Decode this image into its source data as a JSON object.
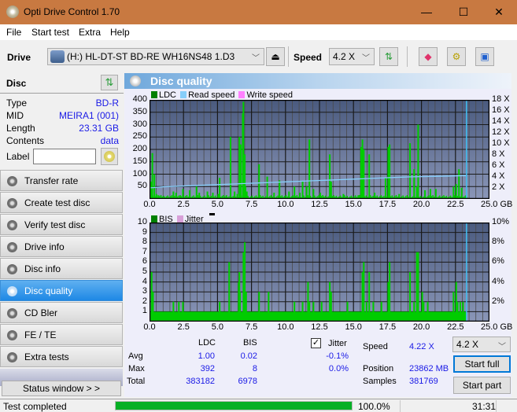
{
  "window": {
    "title": "Opti Drive Control 1.70",
    "minimize": "—",
    "maximize": "☐",
    "close": "✕"
  },
  "menu": [
    "File",
    "Start test",
    "Extra",
    "Help"
  ],
  "toolbar": {
    "drive_label": "Drive",
    "drive_value": "(H:)   HL-DT-ST BD-RE  WH16NS48 1.D3",
    "speed_label": "Speed",
    "speed_value": "4.2 X",
    "icons": [
      "eject-icon",
      "refresh-icon",
      "eraser-icon",
      "settings-icon",
      "save-icon"
    ]
  },
  "disc": {
    "header": "Disc",
    "type_label": "Type",
    "type_value": "BD-R",
    "mid_label": "MID",
    "mid_value": "MEIRA1 (001)",
    "length_label": "Length",
    "length_value": "23.31 GB",
    "contents_label": "Contents",
    "contents_value": "data",
    "label_label": "Label",
    "label_value": ""
  },
  "nav": [
    {
      "label": "Transfer rate",
      "active": false
    },
    {
      "label": "Create test disc",
      "active": false
    },
    {
      "label": "Verify test disc",
      "active": false
    },
    {
      "label": "Drive info",
      "active": false
    },
    {
      "label": "Disc info",
      "active": false
    },
    {
      "label": "Disc quality",
      "active": true
    },
    {
      "label": "CD Bler",
      "active": false
    },
    {
      "label": "FE / TE",
      "active": false
    },
    {
      "label": "Extra tests",
      "active": false
    }
  ],
  "status_window_button": "Status window > >",
  "panel": {
    "title": "Disc quality"
  },
  "colors": {
    "ldc": "#008000",
    "bis": "#008000",
    "read_speed": "#87cefa",
    "write_speed": "#ff80ff",
    "jitter": "#d8a0d8",
    "bar_green": "#00cc00",
    "accent": "#1e88e5",
    "progress": "#06b025"
  },
  "chart_data": [
    {
      "type": "bar",
      "title": "LDC / Read speed",
      "legend": [
        "LDC",
        "Read speed",
        "Write speed"
      ],
      "legend_position": "top-left",
      "xlabel": "GB",
      "xlim": [
        0,
        25
      ],
      "x_ticks": [
        "0.0",
        "2.5",
        "5.0",
        "7.5",
        "10.0",
        "12.5",
        "15.0",
        "17.5",
        "20.0",
        "22.5",
        "25.0 GB"
      ],
      "ylim": [
        0,
        400
      ],
      "y_ticks": [
        "400",
        "350",
        "300",
        "250",
        "200",
        "150",
        "100",
        "50"
      ],
      "y2lim": [
        0,
        18
      ],
      "y2_ticks": [
        "18 X",
        "16 X",
        "14 X",
        "12 X",
        "10 X",
        "8 X",
        "6 X",
        "4 X",
        "2 X"
      ],
      "grid": true,
      "end_marker_gb": 23.31,
      "series": [
        {
          "name": "LDC",
          "x": [
            0.05,
            0.15,
            0.3,
            0.45,
            0.6,
            1.0,
            1.7,
            1.9,
            2.2,
            2.4,
            2.9,
            3.4,
            3.6,
            4.2,
            4.6,
            5.0,
            5.1,
            5.6,
            5.9,
            6.2,
            6.4,
            6.55,
            6.65,
            6.8,
            6.85,
            6.95,
            7.0,
            7.1,
            8.0,
            8.6,
            9.1,
            9.5,
            10.2,
            10.6,
            11.0,
            11.2,
            11.5,
            11.7,
            12.0,
            12.5,
            12.7,
            13.2,
            13.3,
            14.2,
            15.3,
            15.5,
            15.6,
            15.7,
            16.1,
            16.5,
            17.3,
            17.5,
            17.6,
            18.3,
            19.1,
            19.4,
            19.6,
            19.7,
            20.2,
            20.6,
            21.0,
            22.3,
            22.5,
            22.7,
            22.9
          ],
          "values": [
            70,
            185,
            100,
            20,
            15,
            10,
            30,
            25,
            15,
            40,
            35,
            50,
            25,
            30,
            25,
            20,
            85,
            15,
            250,
            30,
            20,
            250,
            220,
            345,
            392,
            180,
            50,
            30,
            140,
            90,
            25,
            75,
            30,
            50,
            25,
            70,
            50,
            240,
            40,
            25,
            10,
            180,
            70,
            20,
            15,
            210,
            240,
            200,
            180,
            25,
            85,
            210,
            220,
            20,
            225,
            120,
            50,
            300,
            35,
            40,
            40,
            50,
            60,
            120,
            45
          ]
        },
        {
          "name": "Read speed",
          "x": [
            0,
            1,
            2,
            3,
            4,
            5,
            6,
            7,
            8,
            9,
            10,
            11,
            12,
            13,
            14,
            15,
            16,
            17,
            18,
            19,
            20,
            21,
            22,
            23,
            23.31
          ],
          "values": [
            2.0,
            2.2,
            2.3,
            2.4,
            2.5,
            2.6,
            2.7,
            2.8,
            2.9,
            3.0,
            3.1,
            3.2,
            3.3,
            3.4,
            3.5,
            3.6,
            3.7,
            3.8,
            3.9,
            4.0,
            4.05,
            4.1,
            4.15,
            4.22,
            4.22
          ]
        },
        {
          "name": "Write speed",
          "x": [],
          "values": []
        }
      ]
    },
    {
      "type": "bar",
      "title": "BIS / Jitter",
      "legend": [
        "BIS",
        "Jitter"
      ],
      "legend_position": "top-left",
      "xlabel": "GB",
      "xlim": [
        0,
        25
      ],
      "x_ticks": [
        "0.0",
        "2.5",
        "5.0",
        "7.5",
        "10.0",
        "12.5",
        "15.0",
        "17.5",
        "20.0",
        "22.5",
        "25.0 GB"
      ],
      "ylim": [
        0,
        10
      ],
      "y_ticks": [
        "10",
        "9",
        "8",
        "7",
        "6",
        "5",
        "4",
        "3",
        "2",
        "1"
      ],
      "y2lim": [
        0,
        10
      ],
      "y2_ticks": [
        "10%",
        "8%",
        "6%",
        "4%",
        "2%"
      ],
      "grid": true,
      "end_marker_gb": 23.31,
      "baseline": 1,
      "series": [
        {
          "name": "BIS",
          "x": [
            0.1,
            0.2,
            1.7,
            2.1,
            2.4,
            5.1,
            5.8,
            6.5,
            6.55,
            6.6,
            6.85,
            6.95,
            7.05,
            8.0,
            8.7,
            10.6,
            11.2,
            11.6,
            11.7,
            12.0,
            12.6,
            13.2,
            13.3,
            14.5,
            15.6,
            15.7,
            15.9,
            16.1,
            16.4,
            17.0,
            17.5,
            17.6,
            19.1,
            19.4,
            19.6,
            19.7,
            20.0,
            20.1,
            20.4,
            22.3,
            22.5,
            22.6,
            22.8,
            23.0
          ],
          "values": [
            5,
            3,
            2,
            2,
            2,
            2,
            6,
            4,
            5,
            3,
            7,
            8,
            3,
            3,
            3,
            2,
            2,
            4,
            2,
            2,
            2,
            4,
            3,
            2,
            5,
            6,
            2,
            5,
            2,
            2,
            4,
            6,
            5,
            2,
            7,
            7,
            3,
            2,
            2,
            3,
            4,
            2,
            2,
            2
          ]
        },
        {
          "name": "Jitter",
          "x": [],
          "values": []
        }
      ]
    }
  ],
  "stats": {
    "col_ldc": "LDC",
    "col_bis": "BIS",
    "col_jitter": "Jitter",
    "jitter_checked": true,
    "avg_label": "Avg",
    "avg_ldc": "1.00",
    "avg_bis": "0.02",
    "avg_jitter": "-0.1%",
    "max_label": "Max",
    "max_ldc": "392",
    "max_bis": "8",
    "max_jitter": "0.0%",
    "total_label": "Total",
    "total_ldc": "383182",
    "total_bis": "6978",
    "speed_label": "Speed",
    "speed_value": "4.22 X",
    "position_label": "Position",
    "position_value": "23862 MB",
    "samples_label": "Samples",
    "samples_value": "381769",
    "speed_select": "4.2 X",
    "start_full": "Start full",
    "start_part": "Start part"
  },
  "statusbar": {
    "text": "Test completed",
    "progress": 1.0,
    "percent": "100.0%",
    "time": "31:31"
  }
}
